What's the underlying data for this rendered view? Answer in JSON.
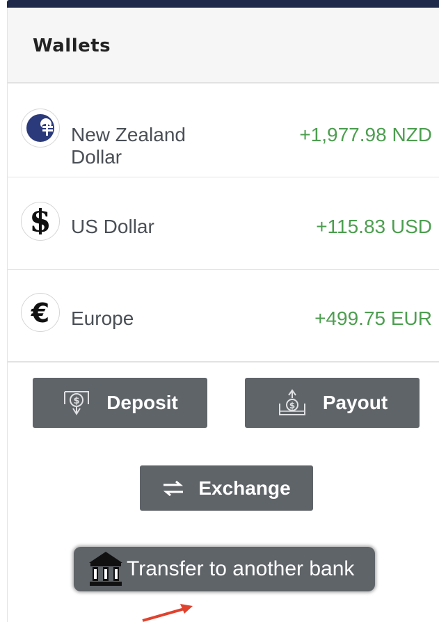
{
  "panel": {
    "title": "Wallets"
  },
  "wallets": [
    {
      "name": "New Zealand Dollar",
      "amount": "+1,977.98 NZD",
      "icon": "nzd-currency-icon"
    },
    {
      "name": "US Dollar",
      "amount": "+115.83 USD",
      "icon": "usd-currency-icon"
    },
    {
      "name": "Europe",
      "amount": "+499.75 EUR",
      "icon": "euro-currency-icon"
    }
  ],
  "actions": {
    "deposit_label": "Deposit",
    "payout_label": "Payout",
    "exchange_label": "Exchange",
    "transfer_label": "Transfer to another bank"
  },
  "colors": {
    "header_bar": "#1f2a4a",
    "amount_positive": "#4c9e4f",
    "button_bg": "#5f6469",
    "annotation_arrow": "#e0422e"
  }
}
